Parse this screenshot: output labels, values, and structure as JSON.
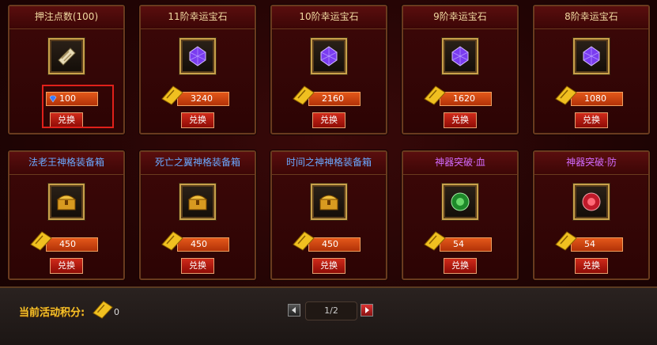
{
  "cards": [
    {
      "title": "押注点数(100)",
      "title_color": "gold",
      "icon": "bet-ticket-icon",
      "price": "100",
      "price_icon": "diamond-icon",
      "button": "兑换"
    },
    {
      "title": "11阶幸运宝石",
      "title_color": "gold",
      "icon": "purple-gem-icon",
      "price": "3240",
      "price_icon": "gold-ticket-icon",
      "button": "兑换"
    },
    {
      "title": "10阶幸运宝石",
      "title_color": "gold",
      "icon": "purple-gem-icon",
      "price": "2160",
      "price_icon": "gold-ticket-icon",
      "button": "兑换"
    },
    {
      "title": "9阶幸运宝石",
      "title_color": "gold",
      "icon": "purple-gem-icon",
      "price": "1620",
      "price_icon": "gold-ticket-icon",
      "button": "兑换"
    },
    {
      "title": "8阶幸运宝石",
      "title_color": "gold",
      "icon": "purple-gem-icon",
      "price": "1080",
      "price_icon": "gold-ticket-icon",
      "button": "兑换"
    },
    {
      "title": "法老王神格装备箱",
      "title_color": "blue",
      "icon": "treasure-chest-icon",
      "price": "450",
      "price_icon": "gold-ticket-icon",
      "button": "兑换"
    },
    {
      "title": "死亡之翼神格装备箱",
      "title_color": "blue",
      "icon": "treasure-chest-icon",
      "price": "450",
      "price_icon": "gold-ticket-icon",
      "button": "兑换"
    },
    {
      "title": "时间之神神格装备箱",
      "title_color": "blue",
      "icon": "treasure-chest-icon",
      "price": "450",
      "price_icon": "gold-ticket-icon",
      "button": "兑换"
    },
    {
      "title": "神器突破·血",
      "title_color": "purple",
      "icon": "green-orb-icon",
      "price": "54",
      "price_icon": "gold-ticket-icon",
      "button": "兑换"
    },
    {
      "title": "神器突破·防",
      "title_color": "purple",
      "icon": "red-orb-icon",
      "price": "54",
      "price_icon": "gold-ticket-icon",
      "button": "兑换"
    }
  ],
  "footer": {
    "points_label": "当前活动积分:",
    "points_value": "0",
    "page_indicator": "1/2"
  },
  "colors": {
    "title_gold": "#f0d8a0",
    "title_blue": "#6aa8ff",
    "title_purple": "#d36bff",
    "price_bg": "#d04810",
    "highlight": "#e0201a"
  }
}
